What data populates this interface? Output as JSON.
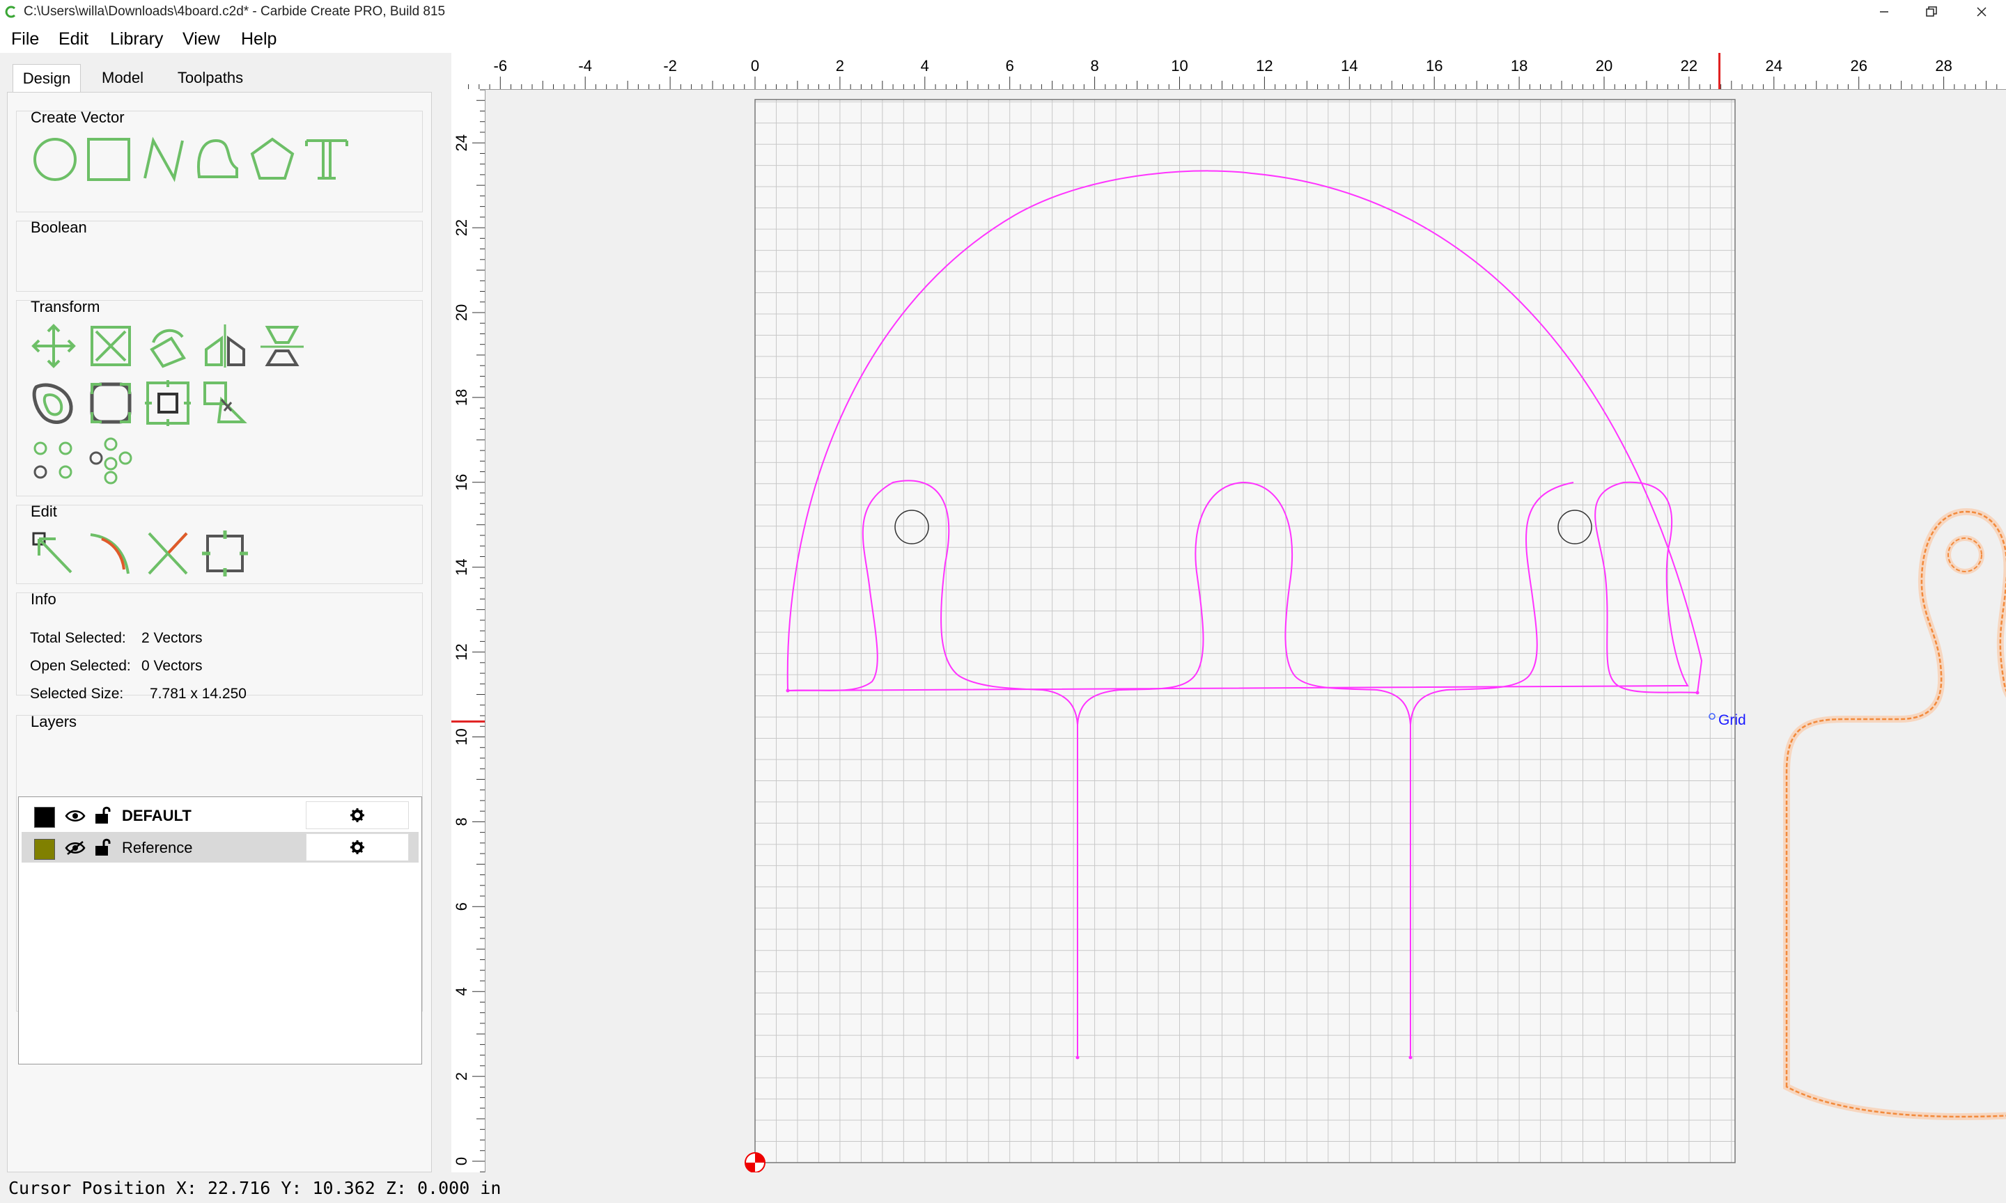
{
  "window": {
    "title": "C:\\Users\\willa\\Downloads\\4board.c2d* - Carbide Create PRO, Build 815"
  },
  "menu": {
    "items": [
      {
        "label": "File"
      },
      {
        "label": "Edit"
      },
      {
        "label": "Library"
      },
      {
        "label": "View"
      },
      {
        "label": "Help"
      }
    ]
  },
  "tabs": [
    {
      "label": "Design",
      "active": true
    },
    {
      "label": "Model",
      "active": false
    },
    {
      "label": "Toolpaths",
      "active": false
    }
  ],
  "panels": {
    "create_vector": {
      "title": "Create Vector",
      "tools": [
        "circle-icon",
        "rectangle-icon",
        "polyline-icon",
        "curve-icon",
        "polygon-icon",
        "text-icon"
      ]
    },
    "boolean": {
      "title": "Boolean"
    },
    "transform": {
      "title": "Transform",
      "tools": [
        "move-icon",
        "scale-icon",
        "rotate-icon",
        "mirror-icon",
        "align-icon",
        "offset-icon",
        "fillet-icon",
        "array-icon",
        "shear-icon",
        "circular-pattern-icon",
        "linear-pattern-icon"
      ]
    },
    "edit": {
      "title": "Edit",
      "tools": [
        "node-edit-icon",
        "smooth-node-icon",
        "trim-icon",
        "bounding-box-icon"
      ]
    },
    "info": {
      "title": "Info",
      "rows": [
        {
          "label": "Total Selected:",
          "value": "2 Vectors"
        },
        {
          "label": "Open Selected:",
          "value": "0 Vectors"
        },
        {
          "label": "Selected Size:",
          "value": "7.781 x 14.250"
        }
      ]
    },
    "layers": {
      "title": "Layers",
      "items": [
        {
          "name": "DEFAULT",
          "color": "#000000",
          "visible": true,
          "locked": false,
          "bold": true
        },
        {
          "name": "Reference",
          "color": "#808000",
          "visible": false,
          "locked": false,
          "bold": false
        }
      ]
    }
  },
  "rulers": {
    "x_labels": [
      "-6",
      "-4",
      "-2",
      "0",
      "2",
      "4",
      "6",
      "8",
      "10",
      "12",
      "14",
      "16",
      "18",
      "20",
      "22",
      "24",
      "26",
      "28"
    ],
    "y_labels": [
      "0",
      "2",
      "4",
      "6",
      "8",
      "10",
      "12",
      "14",
      "16",
      "18",
      "20",
      "22",
      "24"
    ],
    "cursor_marker_x": 22.716,
    "cursor_marker_y": 10.362
  },
  "canvas": {
    "grid_label": "Grid",
    "colors": {
      "selected_vector": "#ff33ff",
      "reference_path": "#f28a3c",
      "grid_line": "#c8c8c8",
      "ruler_marker": "#e02020"
    }
  },
  "status": {
    "text": "Cursor Position X: 22.716 Y: 10.362 Z: 0.000 in"
  }
}
